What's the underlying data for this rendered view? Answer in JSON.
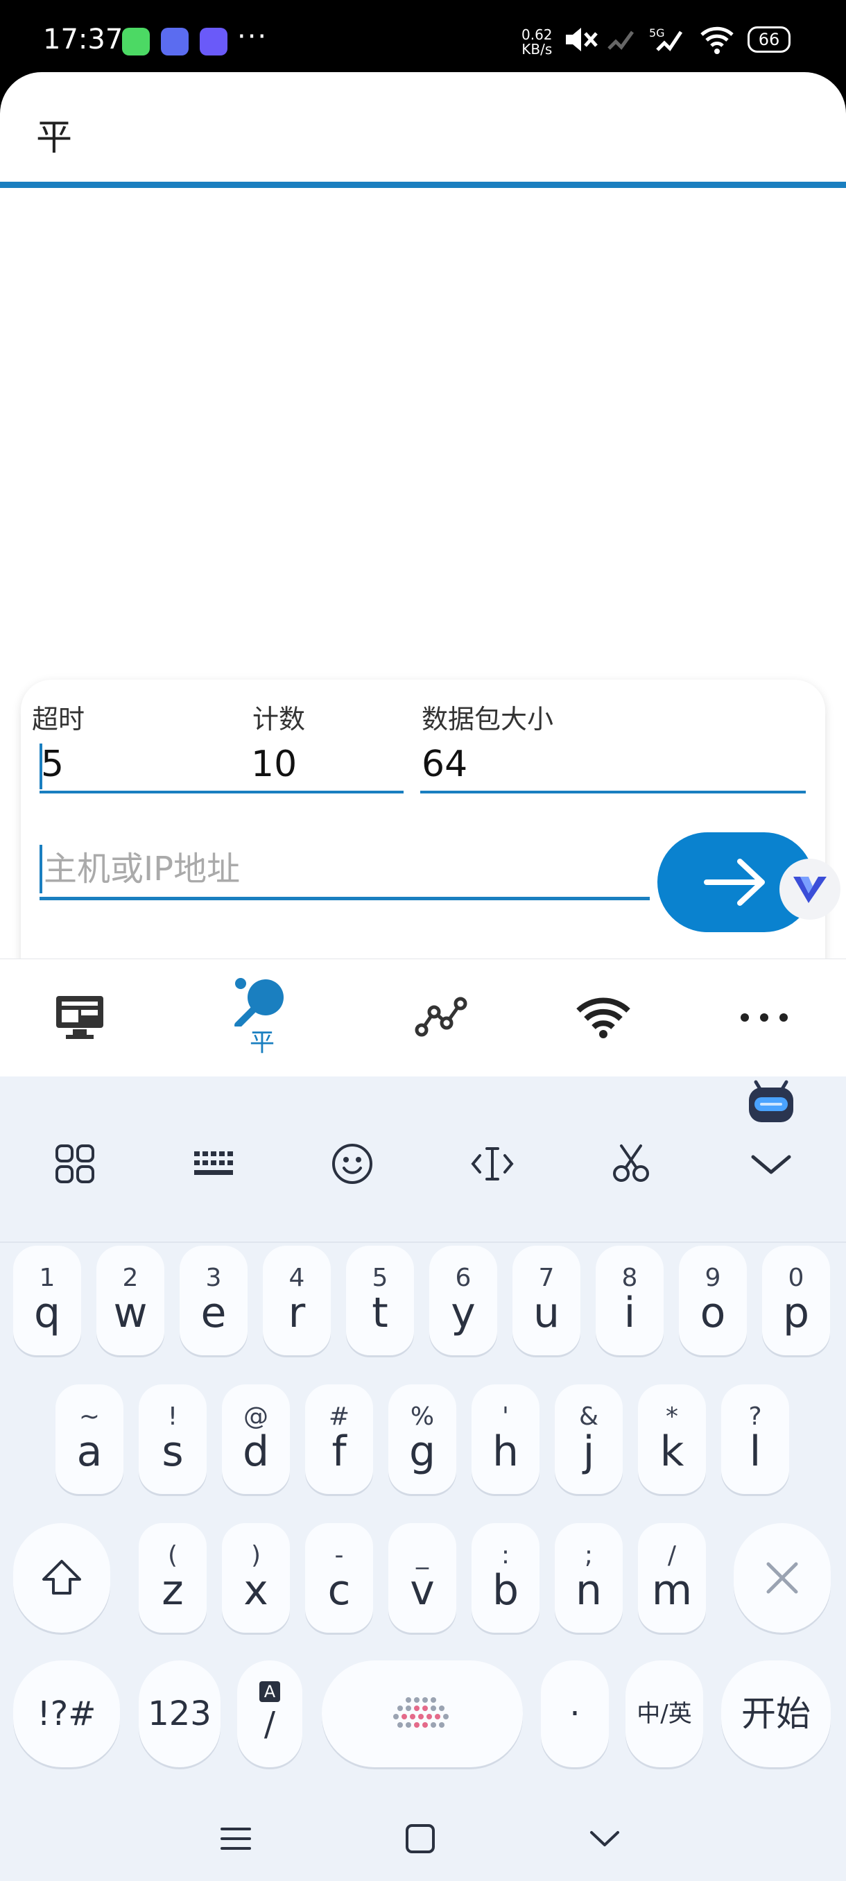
{
  "status_bar": {
    "time": "17:37",
    "net_speed_value": "0.62",
    "net_speed_unit": "KB/s",
    "network_type": "5G",
    "battery": "66",
    "more": "···"
  },
  "app": {
    "title": "平",
    "form": {
      "timeout_label": "超时",
      "timeout_value": "5",
      "count_label": "计数",
      "count_value": "10",
      "packet_size_label": "数据包大小",
      "packet_size_value": "64",
      "host_placeholder": "主机或IP地址"
    },
    "bottom_nav": [
      {
        "icon": "monitor-icon",
        "label": ""
      },
      {
        "icon": "ping-pong-icon",
        "label": "平",
        "active": true
      },
      {
        "icon": "graph-icon",
        "label": ""
      },
      {
        "icon": "wifi-icon",
        "label": ""
      },
      {
        "icon": "more-icon",
        "label": ""
      }
    ]
  },
  "keyboard": {
    "row1": [
      {
        "hint": "1",
        "main": "q"
      },
      {
        "hint": "2",
        "main": "w"
      },
      {
        "hint": "3",
        "main": "e"
      },
      {
        "hint": "4",
        "main": "r"
      },
      {
        "hint": "5",
        "main": "t"
      },
      {
        "hint": "6",
        "main": "y"
      },
      {
        "hint": "7",
        "main": "u"
      },
      {
        "hint": "8",
        "main": "i"
      },
      {
        "hint": "9",
        "main": "o"
      },
      {
        "hint": "0",
        "main": "p"
      }
    ],
    "row2": [
      {
        "hint": "~",
        "main": "a"
      },
      {
        "hint": "!",
        "main": "s"
      },
      {
        "hint": "@",
        "main": "d"
      },
      {
        "hint": "#",
        "main": "f"
      },
      {
        "hint": "%",
        "main": "g"
      },
      {
        "hint": "'",
        "main": "h"
      },
      {
        "hint": "&",
        "main": "j"
      },
      {
        "hint": "*",
        "main": "k"
      },
      {
        "hint": "?",
        "main": "l"
      }
    ],
    "row3": [
      {
        "hint": "(",
        "main": "z"
      },
      {
        "hint": ")",
        "main": "x"
      },
      {
        "hint": "-",
        "main": "c"
      },
      {
        "hint": "_",
        "main": "v"
      },
      {
        "hint": ":",
        "main": "b"
      },
      {
        "hint": ";",
        "main": "n"
      },
      {
        "hint": "/",
        "main": "m"
      }
    ],
    "symbols_key": "!?#",
    "numbers_key": "123",
    "slash_key_hint": "A",
    "slash_key": "/",
    "period_key": "·",
    "lang_key": "中/英",
    "enter_key": "开始"
  }
}
